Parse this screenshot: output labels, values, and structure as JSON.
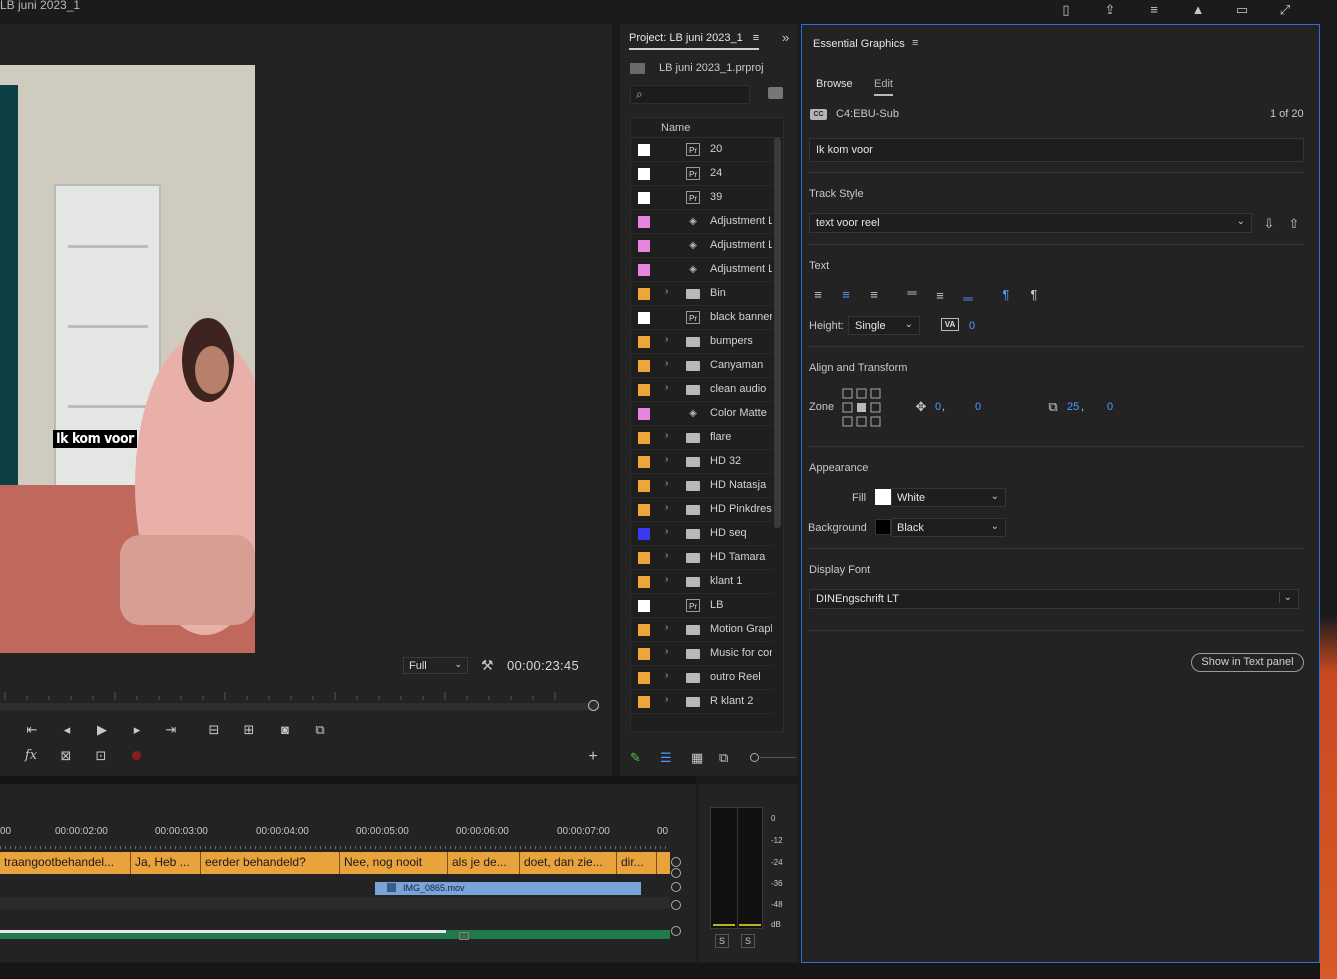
{
  "window": {
    "title": "LB juni 2023_1"
  },
  "monitor": {
    "subtitle_overlay": "Ik kom voor",
    "zoom": "Full",
    "timecode": "00:00:23:45"
  },
  "project": {
    "tab": "Project: LB juni 2023_1",
    "file": "LB juni 2023_1.prproj",
    "column_name": "Name",
    "items": [
      {
        "name": "20",
        "color": "#ffffff",
        "type": "pr",
        "expand": false
      },
      {
        "name": "24",
        "color": "#ffffff",
        "type": "pr",
        "expand": false
      },
      {
        "name": "39",
        "color": "#ffffff",
        "type": "pr",
        "expand": false
      },
      {
        "name": "Adjustment Layer",
        "color": "#e884e0",
        "type": "adj",
        "expand": false
      },
      {
        "name": "Adjustment Layer",
        "color": "#e884e0",
        "type": "adj",
        "expand": false
      },
      {
        "name": "Adjustment Layer",
        "color": "#e884e0",
        "type": "adj",
        "expand": false
      },
      {
        "name": "Bin",
        "color": "#f0a53a",
        "type": "folder",
        "expand": true
      },
      {
        "name": "black banner",
        "color": "#ffffff",
        "type": "pr",
        "expand": false
      },
      {
        "name": "bumpers",
        "color": "#f0a53a",
        "type": "folder",
        "expand": true
      },
      {
        "name": "Canyaman",
        "color": "#f0a53a",
        "type": "folder",
        "expand": true
      },
      {
        "name": "clean audio",
        "color": "#f0a53a",
        "type": "folder",
        "expand": true
      },
      {
        "name": "Color Matte",
        "color": "#e884e0",
        "type": "adj",
        "expand": false
      },
      {
        "name": "flare",
        "color": "#f0a53a",
        "type": "folder",
        "expand": true
      },
      {
        "name": "HD 32",
        "color": "#f0a53a",
        "type": "folder",
        "expand": true
      },
      {
        "name": "HD Natasja",
        "color": "#f0a53a",
        "type": "folder",
        "expand": true
      },
      {
        "name": "HD Pinkdress",
        "color": "#f0a53a",
        "type": "folder",
        "expand": true
      },
      {
        "name": "HD seq",
        "color": "#3a3aee",
        "type": "folder",
        "expand": true
      },
      {
        "name": "HD Tamara",
        "color": "#f0a53a",
        "type": "folder",
        "expand": true
      },
      {
        "name": "klant 1",
        "color": "#f0a53a",
        "type": "folder",
        "expand": true
      },
      {
        "name": "LB",
        "color": "#ffffff",
        "type": "pr",
        "expand": false
      },
      {
        "name": "Motion Graphics",
        "color": "#f0a53a",
        "type": "folder",
        "expand": true
      },
      {
        "name": "Music for content",
        "color": "#f0a53a",
        "type": "folder",
        "expand": true
      },
      {
        "name": "outro Reel",
        "color": "#f0a53a",
        "type": "folder",
        "expand": true
      },
      {
        "name": "R klant 2",
        "color": "#f0a53a",
        "type": "folder",
        "expand": true
      }
    ]
  },
  "essential_graphics": {
    "title": "Essential Graphics",
    "tabs": {
      "browse": "Browse",
      "edit": "Edit"
    },
    "caption_track": "C4:EBU-Sub",
    "counter": "1 of 20",
    "caption_text": "Ik kom voor",
    "track_style_label": "Track Style",
    "track_style_value": "text voor reel",
    "text_label": "Text",
    "height_label": "Height:",
    "height_value": "Single",
    "tracking_value": "0",
    "align_label": "Align and Transform",
    "zone_label": "Zone",
    "pos_x": "0",
    "pos_y": "0",
    "scale_x": "25",
    "scale_y": "0",
    "appearance_label": "Appearance",
    "fill_label": "Fill",
    "fill_value": "White",
    "background_label": "Background",
    "background_value": "Black",
    "font_label": "Display Font",
    "font_value": "DINEngschrift LT",
    "show_button": "Show in Text panel"
  },
  "timeline": {
    "ticks": [
      "00",
      "00:00:02:00",
      "00:00:03:00",
      "00:00:04:00",
      "00:00:05:00",
      "00:00:06:00",
      "00:00:07:00",
      "00"
    ],
    "captions": [
      {
        "text": "traangootbehandel...",
        "width": 131
      },
      {
        "text": "Ja, Heb ...",
        "width": 70
      },
      {
        "text": "eerder behandeld?",
        "width": 139
      },
      {
        "text": "Nee, nog nooit",
        "width": 108
      },
      {
        "text": "als je de...",
        "width": 72
      },
      {
        "text": "doet, dan zie...",
        "width": 97
      },
      {
        "text": "dir...",
        "width": 40
      }
    ],
    "video_clip": "IMG_0865.mov"
  },
  "meter": {
    "scale": [
      "0",
      "-12",
      "-24",
      "-36",
      "-48",
      "dB"
    ],
    "solo_left": "S",
    "solo_right": "S"
  }
}
